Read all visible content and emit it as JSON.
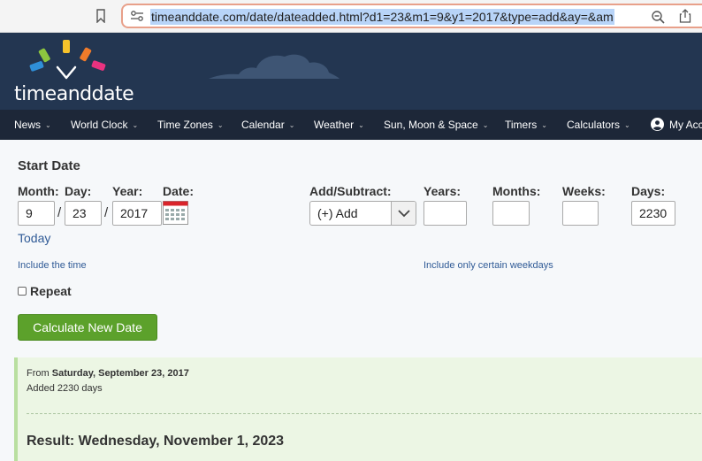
{
  "browser": {
    "url": "timeanddate.com/date/dateadded.html?d1=23&m1=9&y1=2017&type=add&ay=&am"
  },
  "header": {
    "logo_time": "time",
    "logo_and": "and",
    "logo_date": "date"
  },
  "nav": {
    "items": [
      "News",
      "World Clock",
      "Time Zones",
      "Calendar",
      "Weather",
      "Sun, Moon & Space",
      "Timers",
      "Calculators",
      "My Acc"
    ],
    "chevron": "⌄"
  },
  "form": {
    "title": "Start Date",
    "month_label": "Month:",
    "day_label": "Day:",
    "year_label": "Year:",
    "date_label": "Date:",
    "month_value": "9",
    "day_value": "23",
    "year_value": "2017",
    "slash": "/",
    "today_link": "Today",
    "include_time_link": "Include the time",
    "add_subtract_label": "Add/Subtract:",
    "add_subtract_value": "(+) Add",
    "years_label": "Years:",
    "months_label": "Months:",
    "weeks_label": "Weeks:",
    "days_label": "Days:",
    "years_value": "",
    "months_value": "",
    "weeks_value": "",
    "days_value": "2230",
    "weekdays_link": "Include only certain weekdays",
    "repeat_label": "Repeat",
    "calculate_button": "Calculate New Date"
  },
  "result": {
    "from_prefix": "From",
    "from_date": "Saturday, September 23, 2017",
    "added_text": "Added 2230 days",
    "result_text": "Result: Wednesday, November 1, 2023"
  },
  "colors": {
    "header_bg": "#233651",
    "nav_bg": "#1d2738",
    "button_green": "#5ca12b",
    "link_blue": "#2f5a96",
    "result_bg": "#ecf6e4"
  }
}
